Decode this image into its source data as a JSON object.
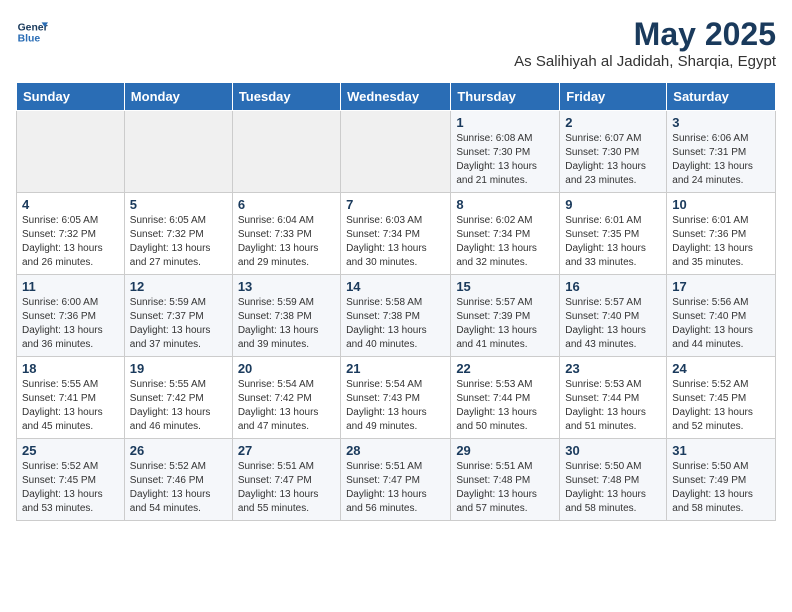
{
  "header": {
    "logo_line1": "General",
    "logo_line2": "Blue",
    "month": "May 2025",
    "location": "As Salihiyah al Jadidah, Sharqia, Egypt"
  },
  "weekdays": [
    "Sunday",
    "Monday",
    "Tuesday",
    "Wednesday",
    "Thursday",
    "Friday",
    "Saturday"
  ],
  "weeks": [
    [
      {
        "day": "",
        "detail": ""
      },
      {
        "day": "",
        "detail": ""
      },
      {
        "day": "",
        "detail": ""
      },
      {
        "day": "",
        "detail": ""
      },
      {
        "day": "1",
        "detail": "Sunrise: 6:08 AM\nSunset: 7:30 PM\nDaylight: 13 hours\nand 21 minutes."
      },
      {
        "day": "2",
        "detail": "Sunrise: 6:07 AM\nSunset: 7:30 PM\nDaylight: 13 hours\nand 23 minutes."
      },
      {
        "day": "3",
        "detail": "Sunrise: 6:06 AM\nSunset: 7:31 PM\nDaylight: 13 hours\nand 24 minutes."
      }
    ],
    [
      {
        "day": "4",
        "detail": "Sunrise: 6:05 AM\nSunset: 7:32 PM\nDaylight: 13 hours\nand 26 minutes."
      },
      {
        "day": "5",
        "detail": "Sunrise: 6:05 AM\nSunset: 7:32 PM\nDaylight: 13 hours\nand 27 minutes."
      },
      {
        "day": "6",
        "detail": "Sunrise: 6:04 AM\nSunset: 7:33 PM\nDaylight: 13 hours\nand 29 minutes."
      },
      {
        "day": "7",
        "detail": "Sunrise: 6:03 AM\nSunset: 7:34 PM\nDaylight: 13 hours\nand 30 minutes."
      },
      {
        "day": "8",
        "detail": "Sunrise: 6:02 AM\nSunset: 7:34 PM\nDaylight: 13 hours\nand 32 minutes."
      },
      {
        "day": "9",
        "detail": "Sunrise: 6:01 AM\nSunset: 7:35 PM\nDaylight: 13 hours\nand 33 minutes."
      },
      {
        "day": "10",
        "detail": "Sunrise: 6:01 AM\nSunset: 7:36 PM\nDaylight: 13 hours\nand 35 minutes."
      }
    ],
    [
      {
        "day": "11",
        "detail": "Sunrise: 6:00 AM\nSunset: 7:36 PM\nDaylight: 13 hours\nand 36 minutes."
      },
      {
        "day": "12",
        "detail": "Sunrise: 5:59 AM\nSunset: 7:37 PM\nDaylight: 13 hours\nand 37 minutes."
      },
      {
        "day": "13",
        "detail": "Sunrise: 5:59 AM\nSunset: 7:38 PM\nDaylight: 13 hours\nand 39 minutes."
      },
      {
        "day": "14",
        "detail": "Sunrise: 5:58 AM\nSunset: 7:38 PM\nDaylight: 13 hours\nand 40 minutes."
      },
      {
        "day": "15",
        "detail": "Sunrise: 5:57 AM\nSunset: 7:39 PM\nDaylight: 13 hours\nand 41 minutes."
      },
      {
        "day": "16",
        "detail": "Sunrise: 5:57 AM\nSunset: 7:40 PM\nDaylight: 13 hours\nand 43 minutes."
      },
      {
        "day": "17",
        "detail": "Sunrise: 5:56 AM\nSunset: 7:40 PM\nDaylight: 13 hours\nand 44 minutes."
      }
    ],
    [
      {
        "day": "18",
        "detail": "Sunrise: 5:55 AM\nSunset: 7:41 PM\nDaylight: 13 hours\nand 45 minutes."
      },
      {
        "day": "19",
        "detail": "Sunrise: 5:55 AM\nSunset: 7:42 PM\nDaylight: 13 hours\nand 46 minutes."
      },
      {
        "day": "20",
        "detail": "Sunrise: 5:54 AM\nSunset: 7:42 PM\nDaylight: 13 hours\nand 47 minutes."
      },
      {
        "day": "21",
        "detail": "Sunrise: 5:54 AM\nSunset: 7:43 PM\nDaylight: 13 hours\nand 49 minutes."
      },
      {
        "day": "22",
        "detail": "Sunrise: 5:53 AM\nSunset: 7:44 PM\nDaylight: 13 hours\nand 50 minutes."
      },
      {
        "day": "23",
        "detail": "Sunrise: 5:53 AM\nSunset: 7:44 PM\nDaylight: 13 hours\nand 51 minutes."
      },
      {
        "day": "24",
        "detail": "Sunrise: 5:52 AM\nSunset: 7:45 PM\nDaylight: 13 hours\nand 52 minutes."
      }
    ],
    [
      {
        "day": "25",
        "detail": "Sunrise: 5:52 AM\nSunset: 7:45 PM\nDaylight: 13 hours\nand 53 minutes."
      },
      {
        "day": "26",
        "detail": "Sunrise: 5:52 AM\nSunset: 7:46 PM\nDaylight: 13 hours\nand 54 minutes."
      },
      {
        "day": "27",
        "detail": "Sunrise: 5:51 AM\nSunset: 7:47 PM\nDaylight: 13 hours\nand 55 minutes."
      },
      {
        "day": "28",
        "detail": "Sunrise: 5:51 AM\nSunset: 7:47 PM\nDaylight: 13 hours\nand 56 minutes."
      },
      {
        "day": "29",
        "detail": "Sunrise: 5:51 AM\nSunset: 7:48 PM\nDaylight: 13 hours\nand 57 minutes."
      },
      {
        "day": "30",
        "detail": "Sunrise: 5:50 AM\nSunset: 7:48 PM\nDaylight: 13 hours\nand 58 minutes."
      },
      {
        "day": "31",
        "detail": "Sunrise: 5:50 AM\nSunset: 7:49 PM\nDaylight: 13 hours\nand 58 minutes."
      }
    ]
  ]
}
